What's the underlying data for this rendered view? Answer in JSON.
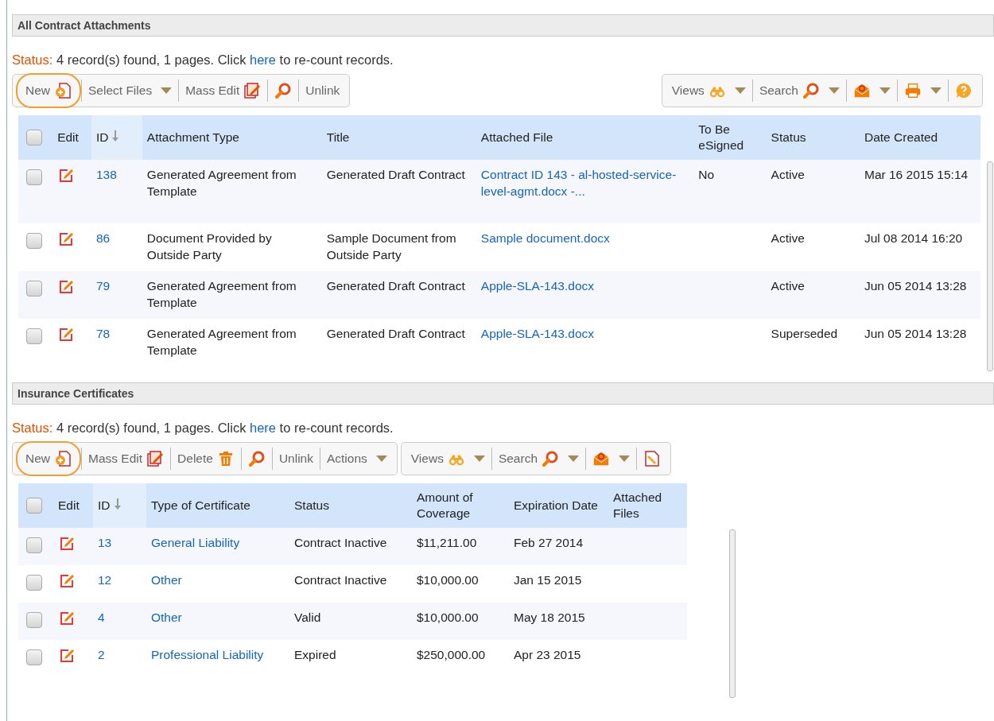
{
  "sections": [
    {
      "title": "All Contract Attachments",
      "status": {
        "label": "Status:",
        "text": "4 record(s) found, 1 pages. Click",
        "link": "here",
        "after": "to re-count records."
      },
      "toolbars": [
        {
          "items": [
            {
              "kind": "new",
              "label": "New",
              "dropdown": false,
              "highlighted": true
            },
            {
              "kind": "plain",
              "label": "Select Files",
              "dropdown": true,
              "highlighted": false
            },
            {
              "kind": "mass-edit",
              "label": "Mass Edit",
              "dropdown": false,
              "highlighted": false
            },
            {
              "kind": "find",
              "dropdown": false,
              "highlighted": false
            },
            {
              "kind": "plain",
              "label": "Unlink",
              "dropdown": false,
              "highlighted": false
            }
          ]
        },
        {
          "items": [
            {
              "kind": "views",
              "label": "Views",
              "dropdown": true,
              "highlighted": false
            },
            {
              "kind": "find",
              "label": "Search",
              "dropdown": true,
              "highlighted": false
            },
            {
              "kind": "email",
              "dropdown": true,
              "highlighted": false
            },
            {
              "kind": "print",
              "dropdown": true,
              "highlighted": false
            },
            {
              "kind": "help",
              "dropdown": false,
              "highlighted": false
            }
          ]
        }
      ],
      "table": {
        "all_checked": false,
        "columns": [
          {
            "label": "Edit",
            "sorted": false,
            "kind": "edit"
          },
          {
            "label": "ID",
            "sorted": true,
            "kind": "link"
          },
          {
            "label": "Attachment Type",
            "sorted": false,
            "kind": "text"
          },
          {
            "label": "Title",
            "sorted": false,
            "kind": "text"
          },
          {
            "label": "Attached File",
            "sorted": false,
            "kind": "link"
          },
          {
            "label": "To Be eSigned",
            "sorted": false,
            "kind": "text"
          },
          {
            "label": "Status",
            "sorted": false,
            "kind": "text"
          },
          {
            "label": "Date Created",
            "sorted": false,
            "kind": "text"
          }
        ],
        "rows": [
          {
            "checked": false,
            "cells": [
              "",
              "138",
              "Generated Agreement from Template",
              "Generated Draft Contract",
              "Contract ID 143 - al-hosted-service-level-agmt.docx -...",
              "No",
              "Active",
              "Mar 16 2015 15:14"
            ]
          },
          {
            "checked": false,
            "cells": [
              "",
              "86",
              "Document Provided by Outside Party",
              "Sample Document from Outside Party",
              "Sample document.docx",
              "",
              "Active",
              "Jul 08 2014 16:20"
            ]
          },
          {
            "checked": false,
            "cells": [
              "",
              "79",
              "Generated Agreement from Template",
              "Generated Draft Contract",
              "Apple-SLA-143.docx",
              "",
              "Active",
              "Jun 05 2014 13:28"
            ]
          },
          {
            "checked": false,
            "cells": [
              "",
              "78",
              "Generated Agreement from Template",
              "Generated Draft Contract",
              "Apple-SLA-143.docx",
              "",
              "Superseded",
              "Jun 05 2014 13:28"
            ]
          }
        ]
      }
    },
    {
      "title": "Insurance Certificates",
      "status": {
        "label": "Status:",
        "text": "4 record(s) found, 1 pages. Click",
        "link": "here",
        "after": "to re-count records."
      },
      "toolbars": [
        {
          "items": [
            {
              "kind": "new",
              "label": "New",
              "dropdown": false,
              "highlighted": true
            },
            {
              "kind": "mass-edit",
              "label": "Mass Edit",
              "dropdown": false,
              "highlighted": false
            },
            {
              "kind": "delete",
              "label": "Delete",
              "dropdown": false,
              "highlighted": false
            },
            {
              "kind": "find",
              "dropdown": false,
              "highlighted": false
            },
            {
              "kind": "plain",
              "label": "Unlink",
              "dropdown": false,
              "highlighted": false
            },
            {
              "kind": "plain",
              "label": "Actions",
              "dropdown": true,
              "highlighted": false
            }
          ]
        },
        {
          "items": [
            {
              "kind": "views",
              "label": "Views",
              "dropdown": true,
              "highlighted": false
            },
            {
              "kind": "find",
              "label": "Search",
              "dropdown": true,
              "highlighted": false
            },
            {
              "kind": "email",
              "dropdown": true,
              "highlighted": false
            },
            {
              "kind": "export",
              "dropdown": false,
              "highlighted": false
            }
          ]
        }
      ],
      "table": {
        "all_checked": false,
        "columns": [
          {
            "label": "Edit",
            "sorted": false,
            "kind": "edit"
          },
          {
            "label": "ID",
            "sorted": true,
            "kind": "link"
          },
          {
            "label": "Type of Certificate",
            "sorted": false,
            "kind": "link"
          },
          {
            "label": "Status",
            "sorted": false,
            "kind": "text"
          },
          {
            "label": "Amount of Coverage",
            "sorted": false,
            "kind": "text"
          },
          {
            "label": "Expiration Date",
            "sorted": false,
            "kind": "text"
          },
          {
            "label": "Attached Files",
            "sorted": false,
            "kind": "text"
          }
        ],
        "rows": [
          {
            "checked": false,
            "cells": [
              "",
              "13",
              "General Liability",
              "Contract Inactive",
              "$11,211.00",
              "Feb 27 2014",
              ""
            ]
          },
          {
            "checked": false,
            "cells": [
              "",
              "12",
              "Other",
              "Contract Inactive",
              "$10,000.00",
              "Jan 15 2015",
              ""
            ]
          },
          {
            "checked": false,
            "cells": [
              "",
              "4",
              "Other",
              "Valid",
              "$10,000.00",
              "May 18 2015",
              ""
            ]
          },
          {
            "checked": false,
            "cells": [
              "",
              "2",
              "Professional Liability",
              "Expired",
              "$250,000.00",
              "Apr 23 2015",
              ""
            ]
          }
        ]
      }
    }
  ]
}
